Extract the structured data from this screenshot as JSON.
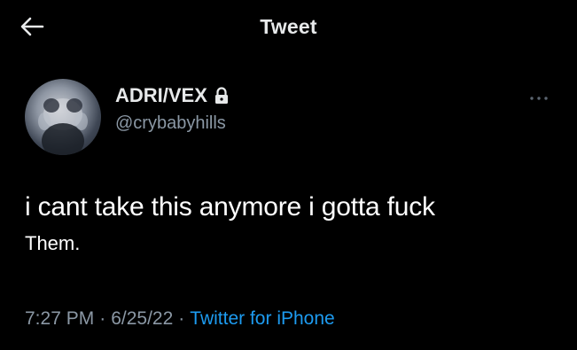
{
  "header": {
    "title": "Tweet",
    "back_icon": "arrow-left-icon"
  },
  "tweet": {
    "author": {
      "display_name": "ADRI/VEX",
      "handle": "@crybabyhills",
      "protected_icon": "lock-icon"
    },
    "more_icon": "more-dots-icon",
    "text_line1": "i cant take this anymore i gotta fuck",
    "text_line2": "Them.",
    "time": "7:27 PM",
    "date": "6/25/22",
    "separator": "·",
    "source": "Twitter for iPhone"
  },
  "colors": {
    "background": "#000000",
    "primary_text": "#e7e9ea",
    "secondary_text": "#8b98a5",
    "link": "#1d9bf0"
  }
}
